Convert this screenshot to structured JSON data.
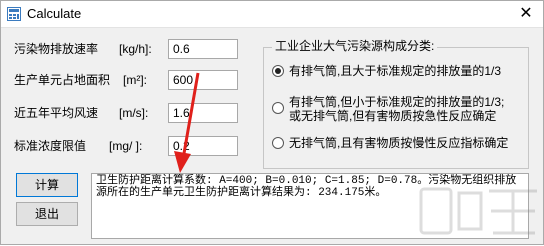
{
  "window": {
    "title": "Calculate",
    "close_glyph": "✕",
    "icon": "app-icon"
  },
  "form": {
    "emission_rate": {
      "label": "污染物排放速率",
      "unit": "[kg/h]:",
      "value": "0.6"
    },
    "area": {
      "label": "生产单元占地面积",
      "unit": "[m²]:",
      "value": "600"
    },
    "wind": {
      "label": "近五年平均风速",
      "unit": "[m/s]:",
      "value": "1.6"
    },
    "standard": {
      "label": "标准浓度限值",
      "unit": "[mg/ ]:",
      "value": "0.2"
    }
  },
  "group": {
    "title": "工业企业大气污染源构成分类:",
    "options": [
      {
        "lines": [
          "有排气筒,且大于标准规定的排放量的1/3"
        ],
        "selected": true
      },
      {
        "lines": [
          "有排气筒,但小于标准规定的排放量的1/3;",
          "或无排气筒,但有害物质按急性反应确定"
        ],
        "selected": false
      },
      {
        "lines": [
          "无排气筒,且有害物质按慢性反应指标确定"
        ],
        "selected": false
      }
    ]
  },
  "buttons": {
    "calculate": "计算",
    "exit": "退出"
  },
  "result_text": "卫生防护距离计算系数: A=400; B=0.010; C=1.85; D=0.78。污染物无组织排放源所在的生产单元卫生防护距离计算结果为: 234.175米。",
  "colors": {
    "arrow": "#e0201b",
    "focus_border": "#0078d7",
    "watermark": "#9a9a9a"
  }
}
